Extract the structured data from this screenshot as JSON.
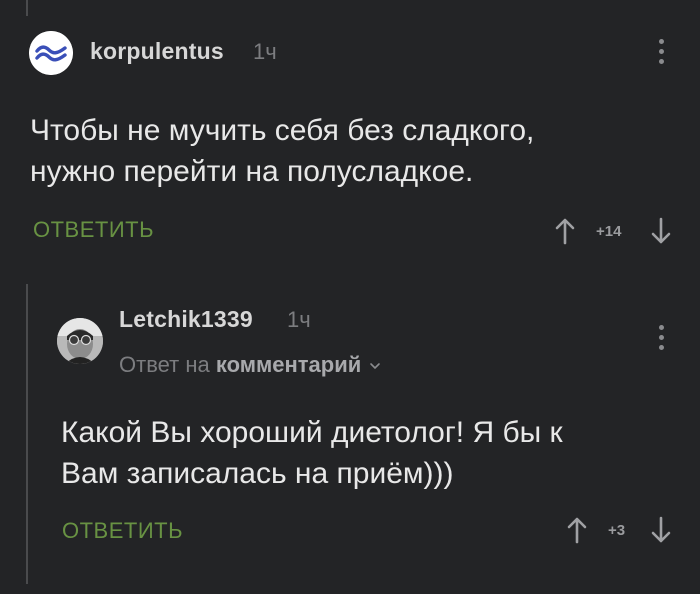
{
  "comments": [
    {
      "username": "korpulentus",
      "time": "1ч",
      "text_lines": [
        "Чтобы не мучить себя без сладкого,",
        "нужно перейти на полусладкое."
      ],
      "reply_label": "ОТВЕТИТЬ",
      "rating": "+14"
    },
    {
      "username": "Letchik1339",
      "time": "1ч",
      "reply_to_prefix": "Ответ на",
      "reply_to_target": "комментарий",
      "text_lines": [
        "Какой Вы хороший диетолог! Я бы к",
        "Вам записалась на приём)))"
      ],
      "reply_label": "ОТВЕТИТЬ",
      "rating": "+3"
    }
  ],
  "colors": {
    "background": "#232426",
    "reply_green": "#689243",
    "muted": "#7c7d80"
  },
  "icons": [
    "avatar-wave-icon",
    "avatar-photo-icon",
    "kebab-menu-icon",
    "arrow-up-icon",
    "arrow-down-icon",
    "chevron-down-icon"
  ]
}
